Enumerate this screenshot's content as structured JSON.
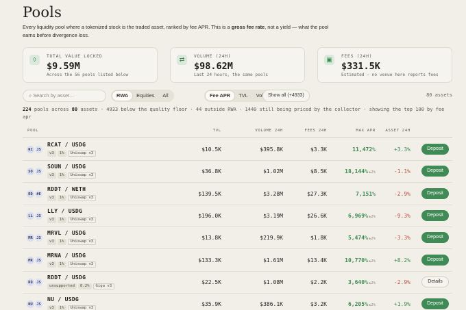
{
  "title": "Pools",
  "intro": {
    "part1": "Every liquidity pool where a tokenized stock is the traded asset, ranked by fee APR. This is a ",
    "bold": "gross fee rate",
    "part2": ", not a yield — what the pool earns before divergence loss."
  },
  "cards": [
    {
      "icon": "drop-icon",
      "glyph": "◊",
      "label": "TOTAL VALUE LOCKED",
      "value": "$9.59M",
      "sub": "Across the 56 pools listed below"
    },
    {
      "icon": "swap-icon",
      "glyph": "⇄",
      "label": "VOLUME (24H)",
      "value": "$98.62M",
      "sub": "Last 24 hours, the same pools"
    },
    {
      "icon": "cash-icon",
      "glyph": "▣",
      "label": "FEES (24H)",
      "value": "$331.5K",
      "sub": "Estimated — no venue here reports fees"
    }
  ],
  "toolbar": {
    "search_placeholder": "⌕ Search by asset…",
    "class_filter": [
      "RWA",
      "Equities",
      "All"
    ],
    "sort_filter": [
      "Fee APR",
      "TVL",
      "Volume"
    ],
    "show_all": "Show all (+4933)",
    "assets_count": "80 assets"
  },
  "summary": {
    "pools": "224",
    "t1": " pools across ",
    "assets": "80",
    "t2": " assets · 4933 below the quality floor · 44 outside RWA · 1440 still being priced by the collector · showing the top 100 by fee apr"
  },
  "table": {
    "headers": {
      "pool": "POOL",
      "tvl": "TVL",
      "vol": "VOLUME 24H",
      "fees": "FEES 24H",
      "apr": "MAX APR",
      "asset": "ASSET 24H"
    },
    "rows": [
      {
        "a": "RC",
        "b": "JS",
        "pair": "RCAT / USDG",
        "tags": [
          "v3",
          "1%",
          "Uniswap v3"
        ],
        "tvl": "$10.5K",
        "vol": "$395.8K",
        "fees": "$3.3K",
        "apr": "11,472%",
        "apr_note": "",
        "delta": "+3.3%",
        "dir": "pos",
        "action": "Deposit"
      },
      {
        "a": "SO",
        "b": "JS",
        "pair": "SOUN / USDG",
        "tags": [
          "v3",
          "1%",
          "Uniswap v3"
        ],
        "tvl": "$36.8K",
        "vol": "$1.02M",
        "fees": "$8.5K",
        "apr": "18,144%",
        "apr_note": "±2%",
        "delta": "-1.1%",
        "dir": "neg",
        "action": "Deposit"
      },
      {
        "a": "RD",
        "b": "#E",
        "pair": "RDDT / WETH",
        "tags": [
          "v3",
          "1%",
          "Uniswap v3"
        ],
        "tvl": "$139.5K",
        "vol": "$3.28M",
        "fees": "$27.3K",
        "apr": "7,151%",
        "apr_note": "",
        "delta": "-2.9%",
        "dir": "neg",
        "action": "Deposit"
      },
      {
        "a": "LL",
        "b": "JS",
        "pair": "LLY / USDG",
        "tags": [
          "v3",
          "1%",
          "Uniswap v3"
        ],
        "tvl": "$196.0K",
        "vol": "$3.19M",
        "fees": "$26.6K",
        "apr": "6,969%",
        "apr_note": "±2%",
        "delta": "-9.3%",
        "dir": "neg",
        "action": "Deposit"
      },
      {
        "a": "MR",
        "b": "JS",
        "pair": "MRVL / USDG",
        "tags": [
          "v3",
          "1%",
          "Uniswap v3"
        ],
        "tvl": "$13.8K",
        "vol": "$219.9K",
        "fees": "$1.8K",
        "apr": "5,474%",
        "apr_note": "±2%",
        "delta": "-3.3%",
        "dir": "neg",
        "action": "Deposit"
      },
      {
        "a": "MR",
        "b": "JS",
        "pair": "MRNA / USDG",
        "tags": [
          "v3",
          "1%",
          "Uniswap v3"
        ],
        "tvl": "$133.3K",
        "vol": "$1.61M",
        "fees": "$13.4K",
        "apr": "10,770%",
        "apr_note": "±2%",
        "delta": "+8.2%",
        "dir": "pos",
        "action": "Deposit"
      },
      {
        "a": "RD",
        "b": "JS",
        "pair": "RDDT / USDG",
        "tags": [
          "unsupported",
          "0.2%",
          "Giga v3"
        ],
        "tvl": "$22.5K",
        "vol": "$1.08M",
        "fees": "$2.2K",
        "apr": "3,640%",
        "apr_note": "±2%",
        "delta": "-2.9%",
        "dir": "neg",
        "action": "Details"
      },
      {
        "a": "NU",
        "b": "JS",
        "pair": "NU / USDG",
        "tags": [
          "v3",
          "1%",
          "Uniswap v3"
        ],
        "tvl": "$35.9K",
        "vol": "$386.1K",
        "fees": "$3.2K",
        "apr": "6,205%",
        "apr_note": "±2%",
        "delta": "+1.9%",
        "dir": "pos",
        "action": "Deposit"
      }
    ]
  }
}
